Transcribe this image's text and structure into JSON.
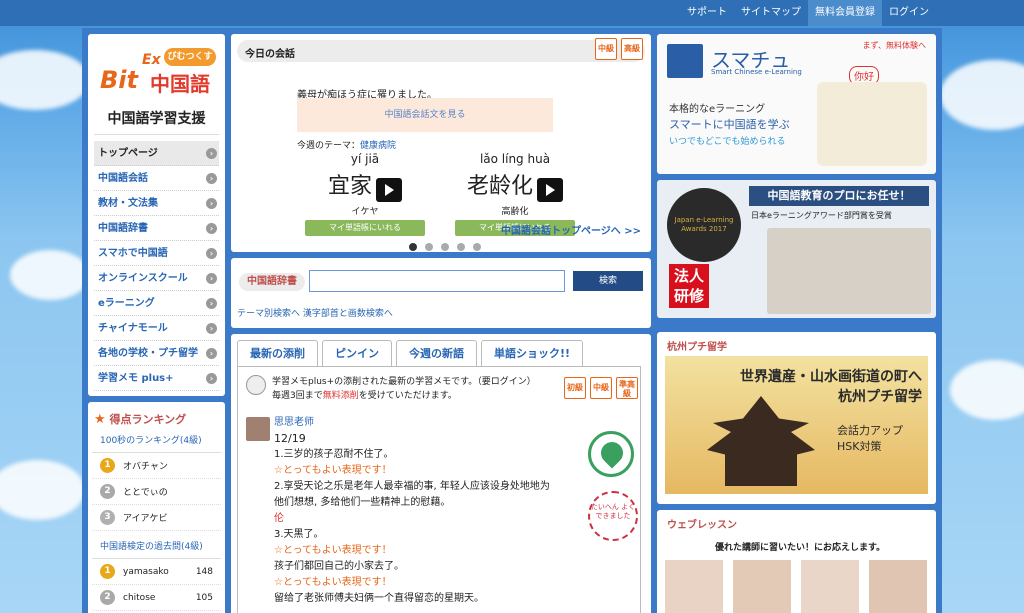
{
  "topnav": {
    "items": [
      "サポート",
      "サイトマップ",
      "無料会員登録",
      "ログイン"
    ],
    "active": 2
  },
  "logo": {
    "bit": "Bit",
    "ex": "Ex",
    "cn": "中国語",
    "bubble": "びむつくす"
  },
  "sidebar": {
    "subtitle": "中国語学習支援",
    "menu": [
      "トップページ",
      "中国語会話",
      "教材・文法集",
      "中国語辞書",
      "スマホで中国語",
      "オンラインスクール",
      "eラーニング",
      "チャイナモール",
      "各地の学校・プチ留学",
      "学習メモ plus+"
    ]
  },
  "ranking": {
    "title": "得点ランキング",
    "sub1": "100秒のランキング(4級)",
    "list1": [
      {
        "rank": "1",
        "name": "オバチャン"
      },
      {
        "rank": "2",
        "name": "ととでぃの"
      },
      {
        "rank": "3",
        "name": "アイアケビ"
      }
    ],
    "sub2": "中国語検定の過去問(4級)",
    "list2": [
      {
        "rank": "1",
        "name": "yamasako",
        "score": "148"
      },
      {
        "rank": "2",
        "name": "chitose",
        "score": "105"
      }
    ]
  },
  "conversation": {
    "title": "今日の会話",
    "levels": [
      "中級",
      "高級"
    ],
    "sentence": "義母が痴ほう症に罹りました。",
    "button": "中国語会話文を見る",
    "theme_label": "今週のテーマ：",
    "theme": "健康病院",
    "words": [
      {
        "pinyin": "yí jiā",
        "hanzi": "宜家",
        "jp": "イケヤ",
        "add": "マイ単語帳にいれる"
      },
      {
        "pinyin": "lǎo líng huà",
        "hanzi": "老龄化",
        "jp": "高齢化",
        "add": "マイ単語帳にいれる"
      }
    ],
    "more": "中国語会話トップページへ >>"
  },
  "dictionary": {
    "label": "中国語辞書",
    "button": "検索",
    "links": "テーマ別検索へ  漢字部首と画数検索へ"
  },
  "memo": {
    "tabs": [
      "最新の添削",
      "ピンイン",
      "今週の新語",
      "単語ショック!!"
    ],
    "levels": [
      "初級",
      "中級",
      "準高級"
    ],
    "intro1": "学習メモplus+の添削された最新の学習メモです。（要ログイン）",
    "intro2a": "毎週3回まで",
    "intro2b": "無料添削",
    "intro2c": "を受けていただけます。",
    "teacher": "思思老师",
    "date": "12/19",
    "lines": [
      {
        "t": "1.三岁的孩子忍耐不住了。",
        "c": ""
      },
      {
        "t": "☆とってもよい表現です！",
        "c": "praise"
      },
      {
        "t": "2.享受天论之乐是老年人最幸福的事, 年轻人应该设身处地地为",
        "c": ""
      },
      {
        "t": "他们想想, 多给他们一些精神上的慰藉。",
        "c": ""
      },
      {
        "t": "伦",
        "c": "fix"
      },
      {
        "t": "3.天黑了。",
        "c": ""
      },
      {
        "t": "☆とってもよい表現です！",
        "c": "praise"
      },
      {
        "t": "孩子们都回自己的小家去了。",
        "c": ""
      },
      {
        "t": "☆とってもよい表現です！",
        "c": "praise"
      },
      {
        "t": "留给了老张师傅夫妇俩一个直得留恋的星期天。",
        "c": ""
      }
    ],
    "stamp2": "たいへん よくできました"
  },
  "right": {
    "sumachu": {
      "name": "スマチュ",
      "en": "Smart Chinese e-Learning",
      "tag": "まず、無料体験へ",
      "hello": "你好",
      "line1": "本格的なeラーニング",
      "line2": "スマートに中国語を学ぶ",
      "line3": "いつでもどこでも始められる"
    },
    "award": {
      "title": "中国語教育のプロにお任せ！",
      "sub": "日本eラーニングアワード部門賞を受賞",
      "badge": "Japan e-Learning Awards 2017",
      "corp": "法人研修"
    },
    "hangzhou": {
      "title": "杭州プチ留学",
      "head1": "世界遺産・山水画街道の町へ",
      "head2": "杭州プチ留学",
      "opt1": "会話力アップ",
      "opt2": "HSK対策"
    },
    "web": {
      "title": "ウェブレッスン",
      "sub": "優れた講師に習いたい！にお応えします。"
    }
  },
  "colors": {
    "topnav": "#2f6fb5",
    "frame": "#3b79c9",
    "link": "#2866b4",
    "accent": "#e8661a",
    "green": "#8ab85a"
  }
}
